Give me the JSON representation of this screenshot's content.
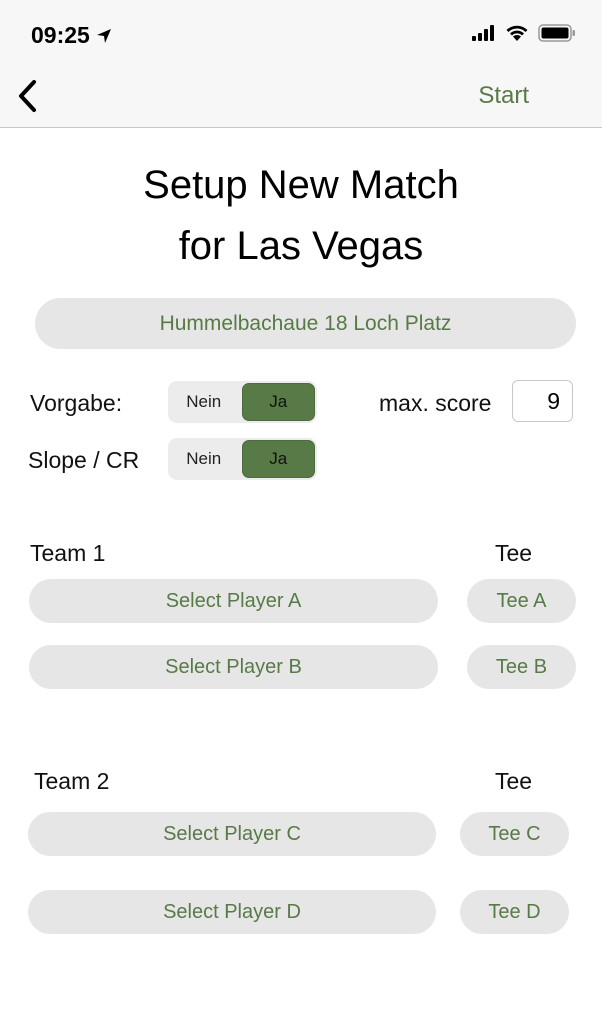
{
  "status_bar": {
    "time": "09:25"
  },
  "nav": {
    "start_label": "Start"
  },
  "title": {
    "line1": "Setup New Match",
    "line2": "for Las Vegas"
  },
  "course": {
    "name": "Hummelbachaue 18 Loch Platz"
  },
  "vorgabe": {
    "label": "Vorgabe:",
    "options": [
      "Nein",
      "Ja"
    ],
    "selected": "Ja"
  },
  "slope": {
    "label": "Slope / CR",
    "options": [
      "Nein",
      "Ja"
    ],
    "selected": "Ja"
  },
  "max_score": {
    "label": "max. score",
    "value": "9"
  },
  "team1": {
    "label": "Team 1",
    "tee_header": "Tee",
    "player_a": "Select Player A",
    "tee_a": "Tee A",
    "player_b": "Select Player B",
    "tee_b": "Tee B"
  },
  "team2": {
    "label": "Team 2",
    "tee_header": "Tee",
    "player_c": "Select Player C",
    "tee_c": "Tee C",
    "player_d": "Select Player D",
    "tee_d": "Tee D"
  },
  "colors": {
    "accent": "#587a47",
    "pill_bg": "#e6e6e6"
  },
  "icons": [
    "location-arrow-icon",
    "signal-icon",
    "wifi-icon",
    "battery-icon",
    "back-chevron-icon"
  ]
}
